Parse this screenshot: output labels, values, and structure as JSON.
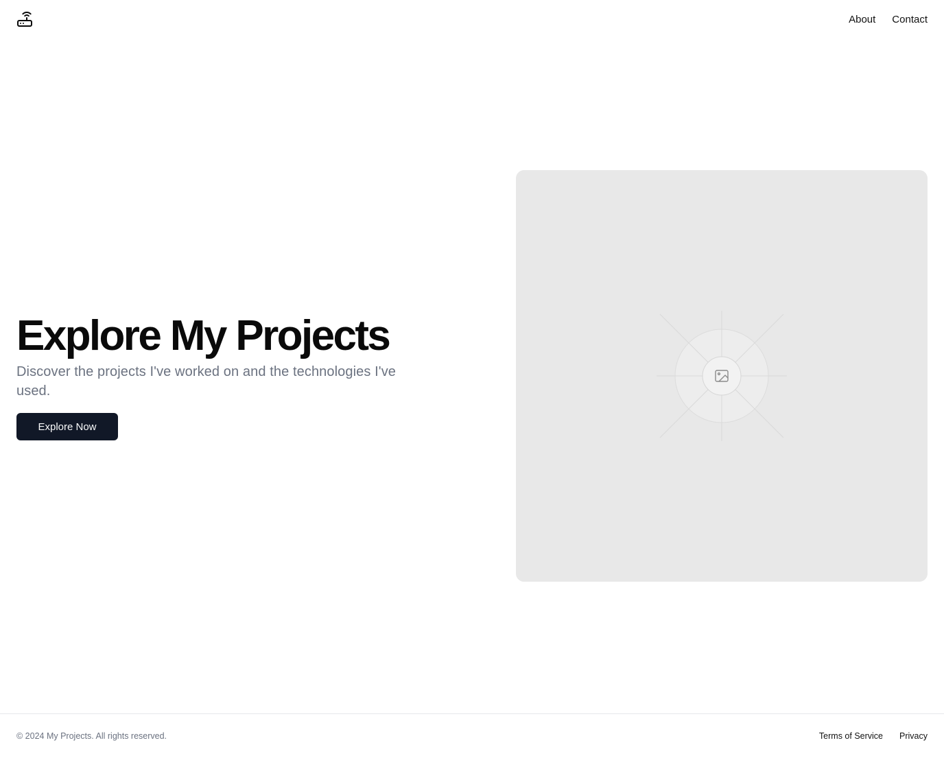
{
  "header": {
    "logo_icon": "router-icon",
    "nav": [
      {
        "label": "About"
      },
      {
        "label": "Contact"
      }
    ]
  },
  "hero": {
    "title": "Explore My Projects",
    "subtitle": "Discover the projects I've worked on and the technologies I've used.",
    "cta_label": "Explore Now"
  },
  "image": {
    "icon": "image-placeholder-icon",
    "background": "#e8e8e8"
  },
  "footer": {
    "copyright": "© 2024 My Projects. All rights reserved.",
    "links": [
      {
        "label": "Terms of Service"
      },
      {
        "label": "Privacy"
      }
    ]
  },
  "colors": {
    "button_bg": "#111827",
    "subtitle_text": "#6b7280",
    "border": "#e5e7eb"
  }
}
